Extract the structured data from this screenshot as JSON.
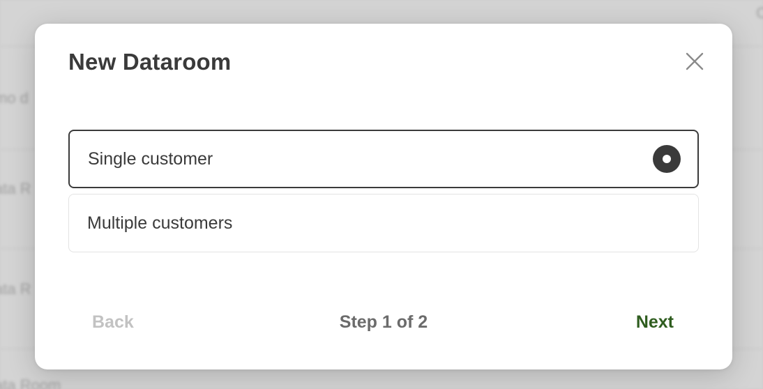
{
  "background": {
    "texts": [
      "mo d",
      "ata R",
      "ata R",
      "ata Room"
    ],
    "corner_text": "C"
  },
  "modal": {
    "title": "New Dataroom",
    "close_icon": "close-icon",
    "options": [
      {
        "label": "Single customer",
        "selected": true
      },
      {
        "label": "Multiple customers",
        "selected": false
      }
    ],
    "footer": {
      "back_label": "Back",
      "step_text": "Step 1 of 2",
      "next_label": "Next"
    }
  },
  "colors": {
    "text_primary": "#3a3a3a",
    "next_accent": "#2f5d1f",
    "back_disabled": "#c2c2c2"
  }
}
